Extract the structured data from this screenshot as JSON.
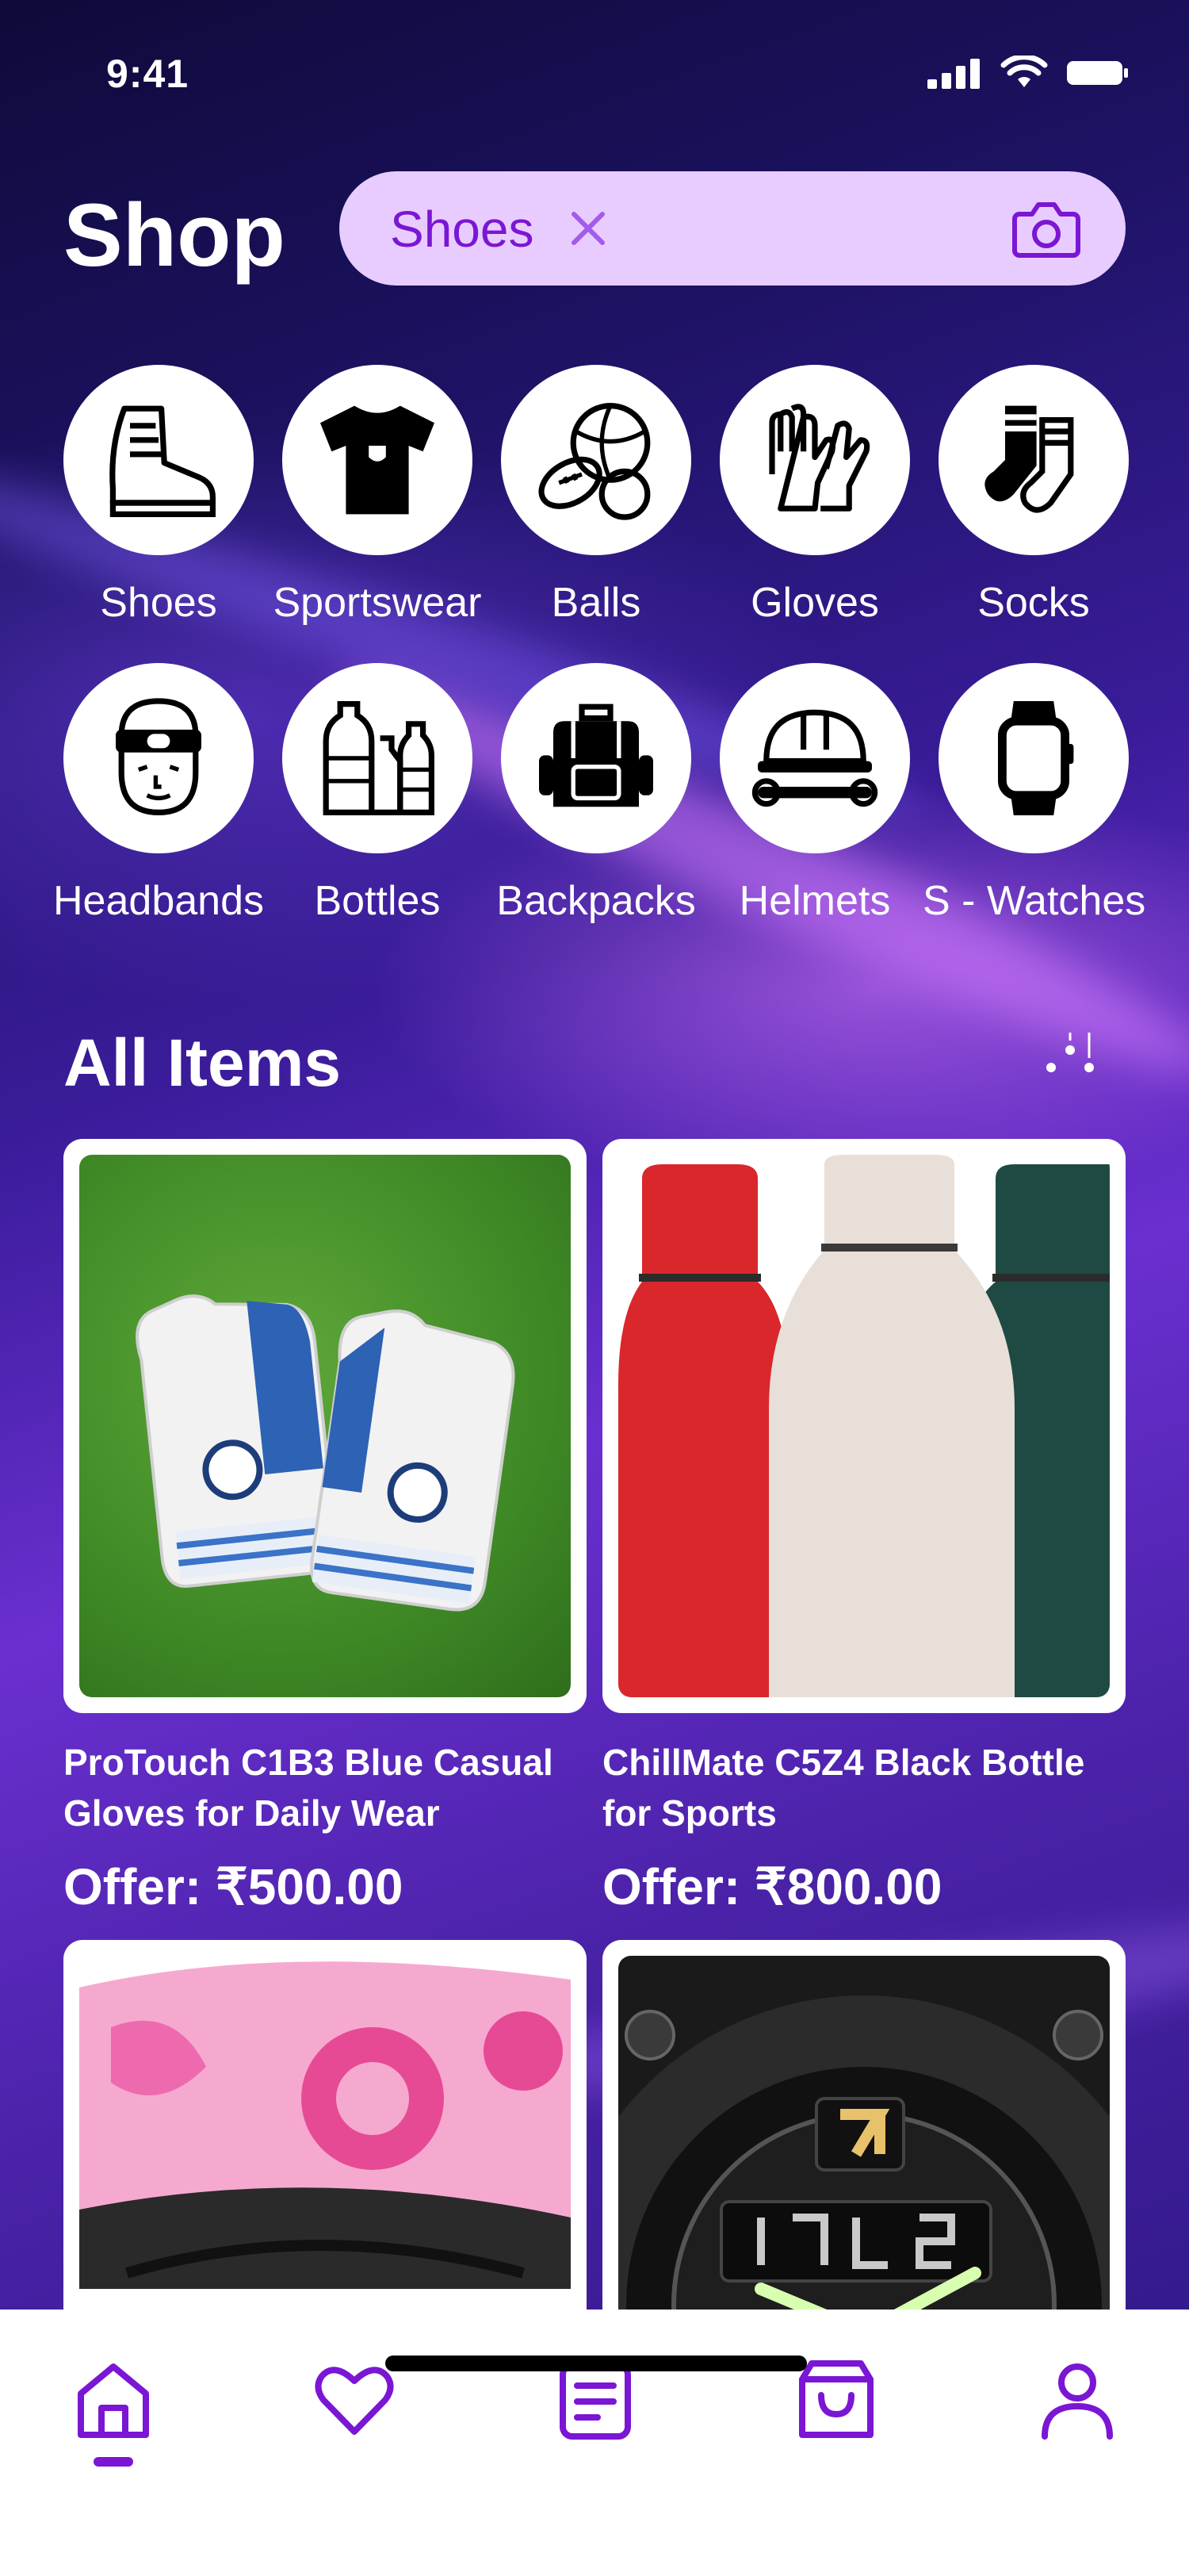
{
  "status_bar": {
    "time": "9:41"
  },
  "header": {
    "title": "Shop"
  },
  "search": {
    "chip_text": "Shoes"
  },
  "categories": [
    {
      "label": "Shoes",
      "icon": "boot-icon"
    },
    {
      "label": "Sportswear",
      "icon": "jersey-icon"
    },
    {
      "label": "Balls",
      "icon": "balls-icon"
    },
    {
      "label": "Gloves",
      "icon": "gloves-icon"
    },
    {
      "label": "Socks",
      "icon": "socks-icon"
    },
    {
      "label": "Headbands",
      "icon": "headband-icon"
    },
    {
      "label": "Bottles",
      "icon": "bottles-icon"
    },
    {
      "label": "Backpacks",
      "icon": "backpack-icon"
    },
    {
      "label": "Helmets",
      "icon": "helmet-icon"
    },
    {
      "label": "S - Watches",
      "icon": "watch-icon"
    }
  ],
  "all_items": {
    "title": "All Items",
    "products": [
      {
        "name": "ProTouch C1B3 Blue Casual Gloves for Daily Wear",
        "price": "Offer: ₹500.00"
      },
      {
        "name": "ChillMate C5Z4 Black Bottle for Sports",
        "price": "Offer: ₹800.00"
      },
      {
        "name": "",
        "price": ""
      },
      {
        "name": "",
        "price": ""
      }
    ]
  },
  "tabbar": {
    "tabs": [
      "home-icon",
      "heart-icon",
      "orders-icon",
      "bag-icon",
      "profile-icon"
    ],
    "active_tab": "home-icon"
  },
  "colors": {
    "accent": "#7a16d4",
    "chip_bg": "#e9ccff"
  }
}
